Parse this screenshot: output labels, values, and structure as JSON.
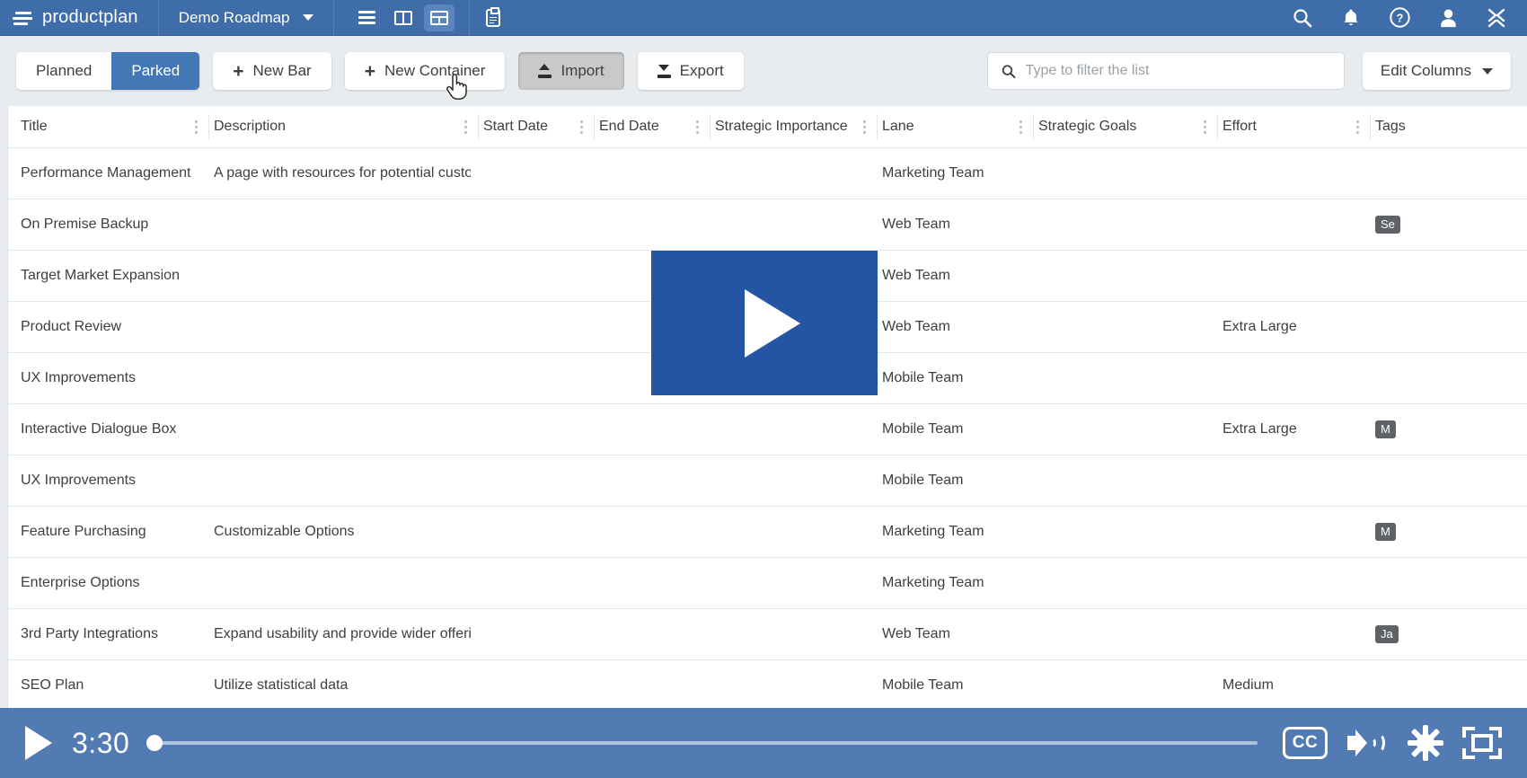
{
  "topnav": {
    "brand": "productplan",
    "roadmap_name": "Demo Roadmap",
    "views": [
      {
        "name": "list-view-icon",
        "label": "List view"
      },
      {
        "name": "board-view-icon",
        "label": "Board view"
      },
      {
        "name": "table-view-icon",
        "label": "Table view",
        "active": true
      }
    ],
    "clipboard_label": "Reports",
    "right_icons": [
      "search-icon",
      "bell-icon",
      "help-icon",
      "user-icon",
      "close-icon"
    ]
  },
  "toolbar": {
    "segments": [
      {
        "label": "Planned",
        "active": false
      },
      {
        "label": "Parked",
        "active": true
      }
    ],
    "new_bar_label": "New Bar",
    "new_container_label": "New Container",
    "import_label": "Import",
    "export_label": "Export",
    "plus_glyph": "+",
    "filter_placeholder": "Type to filter the list",
    "filter_value": "",
    "edit_columns_label": "Edit Columns"
  },
  "table": {
    "columns": [
      {
        "key": "title",
        "label": "Title"
      },
      {
        "key": "description",
        "label": "Description"
      },
      {
        "key": "start_date",
        "label": "Start Date"
      },
      {
        "key": "end_date",
        "label": "End Date"
      },
      {
        "key": "strategic_importance",
        "label": "Strategic Importance"
      },
      {
        "key": "lane",
        "label": "Lane"
      },
      {
        "key": "strategic_goals",
        "label": "Strategic Goals"
      },
      {
        "key": "effort",
        "label": "Effort"
      },
      {
        "key": "tags",
        "label": "Tags"
      }
    ],
    "rows": [
      {
        "title": "Performance Management",
        "description": "A page with resources for potential customers.",
        "start_date": "",
        "end_date": "",
        "strategic_importance": "",
        "lane": "Marketing Team",
        "strategic_goals": "",
        "effort": "",
        "tags": ""
      },
      {
        "title": "On Premise Backup",
        "description": "",
        "start_date": "",
        "end_date": "",
        "strategic_importance": "",
        "lane": "Web Team",
        "strategic_goals": "",
        "effort": "",
        "tags": "Se"
      },
      {
        "title": "Target Market Expansion",
        "description": "",
        "start_date": "",
        "end_date": "",
        "strategic_importance": "",
        "lane": "Web Team",
        "strategic_goals": "",
        "effort": "",
        "tags": ""
      },
      {
        "title": "Product Review",
        "description": "",
        "start_date": "",
        "end_date": "",
        "strategic_importance": "",
        "lane": "Web Team",
        "strategic_goals": "",
        "effort": "Extra Large",
        "tags": ""
      },
      {
        "title": "UX Improvements",
        "description": "",
        "start_date": "",
        "end_date": "",
        "strategic_importance": "",
        "lane": "Mobile Team",
        "strategic_goals": "",
        "effort": "",
        "tags": ""
      },
      {
        "title": "Interactive Dialogue Box",
        "description": "",
        "start_date": "",
        "end_date": "",
        "strategic_importance": "",
        "lane": "Mobile Team",
        "strategic_goals": "",
        "effort": "Extra Large",
        "tags": "M"
      },
      {
        "title": "UX Improvements",
        "description": "",
        "start_date": "",
        "end_date": "",
        "strategic_importance": "",
        "lane": "Mobile Team",
        "strategic_goals": "",
        "effort": "",
        "tags": ""
      },
      {
        "title": "Feature Purchasing",
        "description": "Customizable Options",
        "start_date": "",
        "end_date": "",
        "strategic_importance": "",
        "lane": "Marketing Team",
        "strategic_goals": "",
        "effort": "",
        "tags": "M"
      },
      {
        "title": "Enterprise Options",
        "description": "",
        "start_date": "",
        "end_date": "",
        "strategic_importance": "",
        "lane": "Marketing Team",
        "strategic_goals": "",
        "effort": "",
        "tags": ""
      },
      {
        "title": "3rd Party Integrations",
        "description": "Expand usability and provide wider offering.",
        "start_date": "",
        "end_date": "",
        "strategic_importance": "",
        "lane": "Web Team",
        "strategic_goals": "",
        "effort": "",
        "tags": "Ja"
      },
      {
        "title": "SEO Plan",
        "description": "Utilize statistical data",
        "start_date": "",
        "end_date": "",
        "strategic_importance": "",
        "lane": "Mobile Team",
        "strategic_goals": "",
        "effort": "Medium",
        "tags": ""
      }
    ]
  },
  "video": {
    "play_overlay_label": "Play video",
    "current_time": "3:30",
    "progress_percent": 0,
    "cc_label": "CC",
    "controls": [
      "play-button",
      "cc-button",
      "volume-button",
      "settings-gear-button",
      "fullscreen-button"
    ]
  },
  "colors": {
    "nav_blue": "#3e6daa",
    "accent_blue": "#4278b5",
    "overlay_blue": "#2355a4",
    "toolbar_grey": "#e9ecef",
    "text_dark": "#3c4043",
    "tag_grey": "#5f6368"
  }
}
